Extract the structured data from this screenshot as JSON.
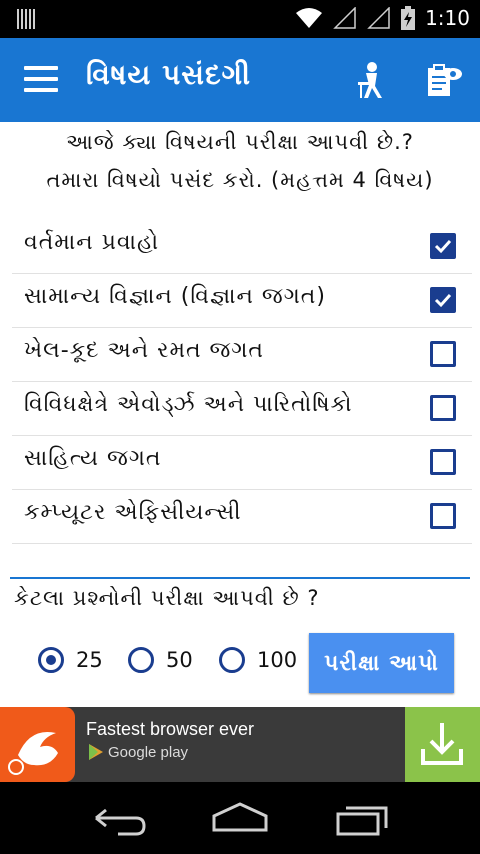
{
  "status_bar": {
    "time": "1:10"
  },
  "app_bar": {
    "title": "વિષય પસંદગી",
    "icons": [
      "menu-icon",
      "exam-person-icon",
      "clipboard-view-icon"
    ]
  },
  "intro": {
    "line1": "આજે ક્યા વિષયની પરીક્ષા આપવી છે.?",
    "line2": "તમારા વિષયો પસંદ કરો. (મહત્તમ 4 વિષય)"
  },
  "subjects": [
    {
      "label": "વર્તમાન પ્રવાહો",
      "checked": true
    },
    {
      "label": "સામાન્ય વિજ્ઞાન (વિજ્ઞાન જગત)",
      "checked": true
    },
    {
      "label": "ખેલ-કૂદ અને રમત જગત",
      "checked": false
    },
    {
      "label": "વિવિધક્ષેત્રે એવોર્ડ્ઝ અને પારિતોષિકો",
      "checked": false
    },
    {
      "label": "સાહિત્ય જગત",
      "checked": false
    },
    {
      "label": "કમ્પ્યૂટર એફિસીયન્સી",
      "checked": false
    }
  ],
  "question": {
    "text": "કેટલા પ્રશ્નોની પરીક્ષા આપવી છે ?",
    "options": [
      "25",
      "50",
      "100"
    ],
    "selected": "25"
  },
  "start_button": {
    "label": "પરીક્ષા આપો"
  },
  "ad": {
    "title": "Fastest browser ever",
    "store": "Google play",
    "brand_color": "#f05a1a",
    "download_color": "#8bc34a"
  },
  "colors": {
    "app_bar": "#1976d2",
    "checkbox": "#1a3d8f",
    "button": "#4a90f0"
  }
}
